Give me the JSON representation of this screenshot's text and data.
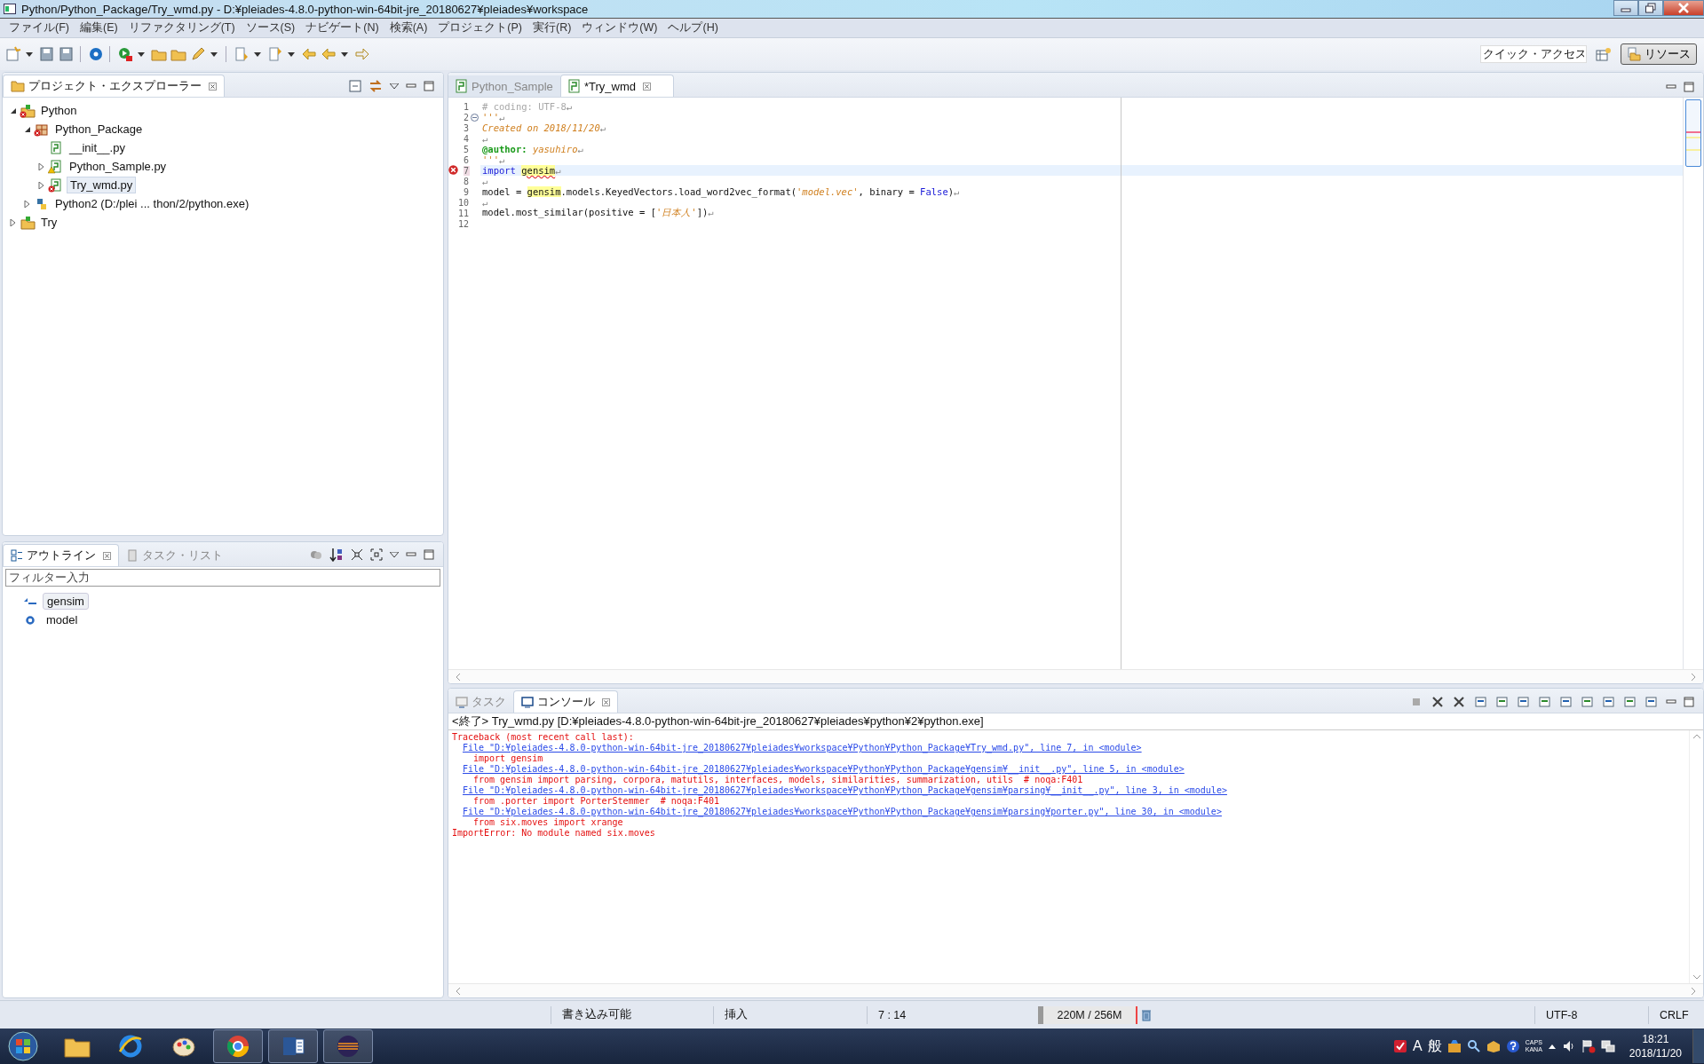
{
  "window": {
    "title": "Python/Python_Package/Try_wmd.py - D:¥pleiades-4.8.0-python-win-64bit-jre_20180627¥pleiades¥workspace"
  },
  "menu": [
    "ファイル(F)",
    "編集(E)",
    "リファクタリング(T)",
    "ソース(S)",
    "ナビゲート(N)",
    "検索(A)",
    "プロジェクト(P)",
    "実行(R)",
    "ウィンドウ(W)",
    "ヘルプ(H)"
  ],
  "quick_access": {
    "placeholder": "クイック・アクセス"
  },
  "perspective": {
    "label": "リソース",
    "selected": true
  },
  "explorer": {
    "title": "プロジェクト・エクスプローラー",
    "tree": [
      {
        "label": "Python",
        "kind": "project",
        "error": true,
        "warning": false,
        "expanded": true,
        "selected": false,
        "children": [
          {
            "label": "Python_Package",
            "kind": "package",
            "error": true,
            "warning": false,
            "expanded": true,
            "selected": false,
            "children": [
              {
                "label": "__init__.py",
                "kind": "init",
                "error": false,
                "warning": false,
                "expanded": false,
                "selected": false
              },
              {
                "label": "Python_Sample.py",
                "kind": "module",
                "error": false,
                "warning": true,
                "expanded": false,
                "selected": false
              },
              {
                "label": "Try_wmd.py",
                "kind": "module",
                "error": true,
                "warning": false,
                "expanded": false,
                "selected": true
              }
            ]
          },
          {
            "label": "Python2  (D:/plei ... thon/2/python.exe)",
            "kind": "interpreter",
            "error": false,
            "warning": false,
            "expanded": false,
            "selected": false
          }
        ]
      },
      {
        "label": "Try",
        "kind": "project",
        "error": false,
        "warning": false,
        "expanded": false,
        "selected": false
      }
    ]
  },
  "outline": {
    "tabs": [
      {
        "label": "アウトライン",
        "selected": true
      },
      {
        "label": "タスク・リスト",
        "selected": false
      }
    ],
    "filter": {
      "placeholder": "フィルター入力"
    },
    "items": [
      {
        "label": "gensim",
        "kind": "import",
        "selected": true
      },
      {
        "label": "model",
        "kind": "variable",
        "selected": false
      }
    ]
  },
  "editor": {
    "tabs": [
      {
        "label": "Python_Sample",
        "selected": false
      },
      {
        "label": "*Try_wmd",
        "selected": true
      }
    ],
    "lines": [
      {
        "number": "1",
        "fold": false,
        "current": false,
        "error": false,
        "tokens": [
          {
            "text": "# coding: UTF-8",
            "kind": "comment"
          },
          {
            "text": "↵",
            "kind": "eol"
          }
        ]
      },
      {
        "number": "2",
        "fold": true,
        "current": false,
        "error": false,
        "tokens": [
          {
            "text": "'''",
            "kind": "string"
          },
          {
            "text": "↵",
            "kind": "eol"
          }
        ]
      },
      {
        "number": "3",
        "fold": false,
        "current": false,
        "error": false,
        "tokens": [
          {
            "text": "Created on 2018/11/20",
            "kind": "string"
          },
          {
            "text": "↵",
            "kind": "eol"
          }
        ]
      },
      {
        "number": "4",
        "fold": false,
        "current": false,
        "error": false,
        "tokens": [
          {
            "text": "↵",
            "kind": "eol"
          }
        ]
      },
      {
        "number": "5",
        "fold": false,
        "current": false,
        "error": false,
        "tokens": [
          {
            "text": "@author:",
            "kind": "decorator"
          },
          {
            "text": "yasuhiro",
            "kind": "string",
            "gap_before": true
          },
          {
            "text": "↵",
            "kind": "eol"
          }
        ]
      },
      {
        "number": "6",
        "fold": false,
        "current": false,
        "error": false,
        "tokens": [
          {
            "text": "'''",
            "kind": "string"
          },
          {
            "text": "↵",
            "kind": "eol"
          }
        ]
      },
      {
        "number": "7",
        "fold": false,
        "current": true,
        "error": true,
        "tokens": [
          {
            "text": "import",
            "kind": "keyword"
          },
          {
            "text": "gensim",
            "kind": "occurrence_error",
            "gap_before": true
          },
          {
            "text": "↵",
            "kind": "eol"
          }
        ]
      },
      {
        "number": "8",
        "fold": false,
        "current": false,
        "error": false,
        "tokens": [
          {
            "text": "↵",
            "kind": "eol"
          }
        ]
      },
      {
        "number": "9",
        "fold": false,
        "current": false,
        "error": false,
        "tokens": [
          {
            "text": "model =",
            "kind": "plain"
          },
          {
            "text": "gensim",
            "kind": "occurrence",
            "gap_before": true
          },
          {
            "text": ".models.KeyedVectors.load_word2vec_format(",
            "kind": "plain"
          },
          {
            "text": "'model.vec'",
            "kind": "string"
          },
          {
            "text": ", binary =",
            "kind": "plain"
          },
          {
            "text": "False",
            "kind": "keyword",
            "gap_before": true
          },
          {
            "text": ")",
            "kind": "plain"
          },
          {
            "text": "↵",
            "kind": "eol"
          }
        ]
      },
      {
        "number": "10",
        "fold": false,
        "current": false,
        "error": false,
        "tokens": [
          {
            "text": "↵",
            "kind": "eol"
          }
        ]
      },
      {
        "number": "11",
        "fold": false,
        "current": false,
        "error": false,
        "tokens": [
          {
            "text": "model.most_similar(positive = [",
            "kind": "plain"
          },
          {
            "text": "'日本人'",
            "kind": "string"
          },
          {
            "text": "])",
            "kind": "plain"
          },
          {
            "text": "↵",
            "kind": "eol"
          }
        ]
      },
      {
        "number": "12",
        "fold": false,
        "current": false,
        "error": false
      }
    ]
  },
  "console": {
    "tabs": [
      {
        "label": "タスク",
        "selected": false
      },
      {
        "label": "コンソール",
        "selected": true
      }
    ],
    "header": "<終了> Try_wmd.py [D:¥pleiades-4.8.0-python-win-64bit-jre_20180627¥pleiades¥python¥2¥python.exe]",
    "lines": [
      {
        "kind": "error",
        "text": "Traceback (most recent call last):"
      },
      {
        "kind": "link",
        "text": "File \"D:¥pleiades-4.8.0-python-win-64bit-jre_20180627¥pleiades¥workspace¥Python¥Python_Package¥Try_wmd.py\", line 7, in <module>"
      },
      {
        "kind": "code",
        "text": "import gensim"
      },
      {
        "kind": "link",
        "text": "File \"D:¥pleiades-4.8.0-python-win-64bit-jre_20180627¥pleiades¥workspace¥Python¥Python_Package¥gensim¥__init__.py\", line 5, in <module>"
      },
      {
        "kind": "code",
        "text": "from gensim import parsing, corpora, matutils, interfaces, models, similarities, summarization, utils  # noqa:F401"
      },
      {
        "kind": "link",
        "text": "File \"D:¥pleiades-4.8.0-python-win-64bit-jre_20180627¥pleiades¥workspace¥Python¥Python_Package¥gensim¥parsing¥__init__.py\", line 3, in <module>"
      },
      {
        "kind": "code",
        "text": "from .porter import PorterStemmer  # noqa:F401"
      },
      {
        "kind": "link",
        "text": "File \"D:¥pleiades-4.8.0-python-win-64bit-jre_20180627¥pleiades¥workspace¥Python¥Python_Package¥gensim¥parsing¥porter.py\", line 30, in <module>"
      },
      {
        "kind": "code",
        "text": "from six.moves import xrange"
      },
      {
        "kind": "error",
        "text": "ImportError: No module named six.moves"
      }
    ]
  },
  "status_bar": {
    "writable": "書き込み可能",
    "insert_mode": "挿入",
    "position": "7 : 14",
    "heap": "220M / 256M",
    "encoding": "UTF-8",
    "line_ending": "CRLF"
  },
  "taskbar": {
    "ime_mode": "A",
    "ime_dict": "般",
    "caps": "CAPS",
    "kana": "KANA",
    "time": "18:21",
    "date": "2018/11/20"
  }
}
